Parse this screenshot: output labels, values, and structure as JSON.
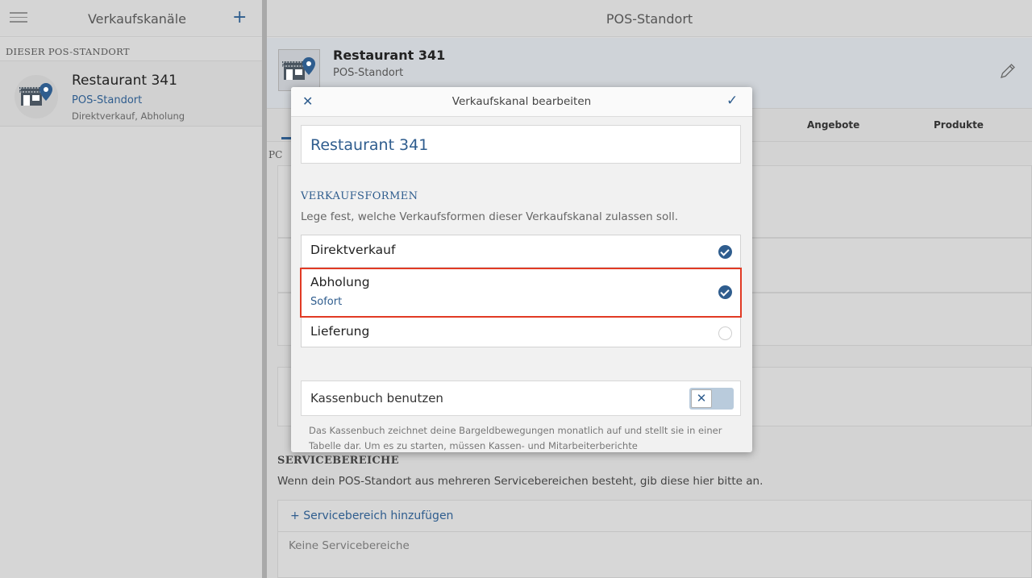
{
  "topbar": {
    "left_title": "Verkaufskanäle",
    "add_symbol": "+",
    "right_title": "POS-Standort"
  },
  "sidebar": {
    "section_label": "DIESER POS-STANDORT",
    "items": [
      {
        "name": "Restaurant 341",
        "type": "POS-Standort",
        "description": "Direktverkauf, Abholung"
      }
    ]
  },
  "main": {
    "name": "Restaurant 341",
    "type": "POS-Standort",
    "tabs": [
      "Angebote",
      "Produkte"
    ],
    "frag_section_prefix": "PC",
    "servicebereiche": {
      "title": "SERVICEBEREICHE",
      "description": "Wenn dein POS-Standort aus mehreren Servicebereichen besteht, gib diese hier bitte an.",
      "add_label": "Servicebereich hinzufügen",
      "empty_label": "Keine Servicebereiche"
    }
  },
  "modal": {
    "title": "Verkaufskanal bearbeiten",
    "close_symbol": "✕",
    "confirm_symbol": "✓",
    "name_value": "Restaurant 341",
    "section_title": "VERKAUFSFORMEN",
    "section_description": "Lege fest, welche Verkaufsformen dieser Verkaufskanal zulassen soll.",
    "options": [
      {
        "name": "Direktverkauf",
        "sub": "",
        "checked": true
      },
      {
        "name": "Abholung",
        "sub": "Sofort",
        "checked": true
      },
      {
        "name": "Lieferung",
        "sub": "",
        "checked": false
      }
    ],
    "toggle_label": "Kassenbuch benutzen",
    "toggle_symbol": "✕",
    "footnote": "Das Kassenbuch zeichnet deine Bargeldbewegungen monatlich auf und stellt sie in einer Tabelle dar. Um es zu starten, müssen Kassen- und Mitarbeiterberichte"
  },
  "colors": {
    "accent": "#2f5d8e",
    "highlight": "#e13a24"
  }
}
